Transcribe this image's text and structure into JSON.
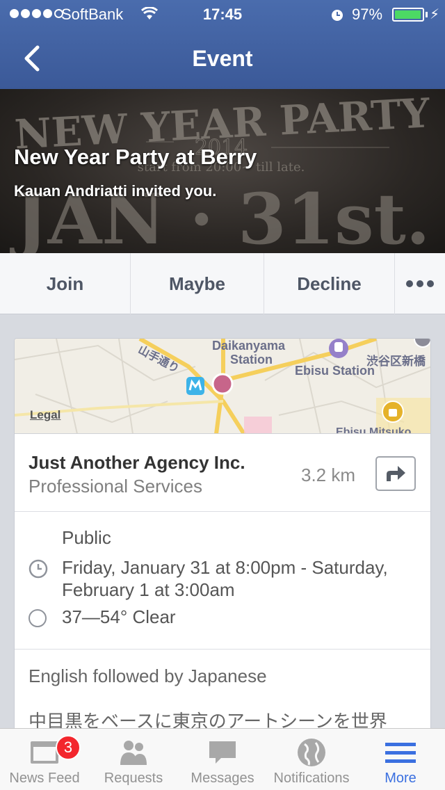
{
  "status_bar": {
    "carrier": "SoftBank",
    "time": "17:45",
    "battery": "97%",
    "battery_level": 0.97
  },
  "nav": {
    "title": "Event"
  },
  "cover": {
    "art_line1": "NEW YEAR PARTY",
    "art_year": "2014",
    "art_time": "start from 20:00~ till late.",
    "art_date": "JAN · 31st.",
    "title": "New Year Party at Berry",
    "subtitle": "Kauan Andriatti invited you."
  },
  "actions": {
    "join": "Join",
    "maybe": "Maybe",
    "decline": "Decline"
  },
  "map": {
    "legal": "Legal",
    "label_daikanyama": "Daikanyama",
    "label_station": "Station",
    "label_ebisu": "Ebisu Station",
    "label_jp_road": "山手通り",
    "label_jp_shibuya": "渋谷区新橋",
    "label_partial": "Ebisu Mitsuko"
  },
  "place": {
    "name": "Just Another Agency Inc.",
    "category": "Professional Services",
    "distance": "3.2 km"
  },
  "details": {
    "privacy": "Public",
    "datetime": "Friday, January 31 at 8:00pm - Saturday, February 1 at 3:00am",
    "weather": "37—54° Clear"
  },
  "description": {
    "line1": "English followed by Japanese",
    "line2": "中目黒をベースに東京のアートシーンを世界"
  },
  "tabbar": {
    "tabs": [
      {
        "label": "News Feed",
        "icon": "news-feed-icon"
      },
      {
        "label": "Requests",
        "icon": "requests-icon"
      },
      {
        "label": "Messages",
        "icon": "messages-icon"
      },
      {
        "label": "Notifications",
        "icon": "globe-icon"
      },
      {
        "label": "More",
        "icon": "menu-icon"
      }
    ],
    "news_feed_badge": "3"
  },
  "colors": {
    "brand": "#3b5998",
    "active_tab": "#3b70e0",
    "badge": "#f3262d"
  }
}
